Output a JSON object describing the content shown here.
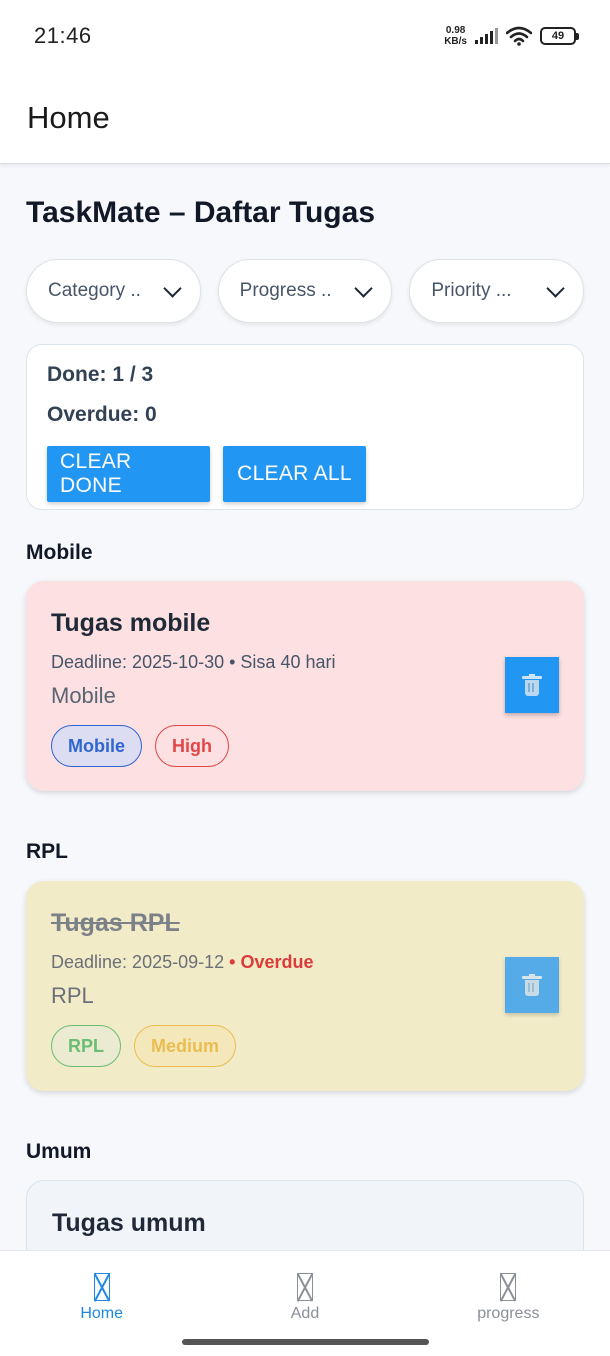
{
  "status_bar": {
    "time": "21:46",
    "net_speed_value": "0.98",
    "net_speed_unit": "KB/s",
    "battery": "49"
  },
  "app_bar": {
    "title": "Home"
  },
  "page": {
    "title": "TaskMate – Daftar Tugas"
  },
  "filters": [
    {
      "label": "Category .."
    },
    {
      "label": "Progress .."
    },
    {
      "label": "Priority ..."
    }
  ],
  "summary": {
    "done": "Done: 1 / 3",
    "overdue": "Overdue: 0",
    "clear_done_label": "CLEAR DONE",
    "clear_all_label": "CLEAR ALL"
  },
  "sections": [
    {
      "heading": "Mobile",
      "task": {
        "title": "Tugas mobile",
        "deadline": "Deadline: 2025-10-30 • Sisa 40 hari",
        "category": "Mobile",
        "chip_category": "Mobile",
        "chip_priority": "High",
        "done": false,
        "card_color": "#fde0e1"
      }
    },
    {
      "heading": "RPL",
      "task": {
        "title": "Tugas RPL",
        "deadline_prefix": "Deadline: 2025-09-12 ",
        "deadline_status": "• Overdue",
        "category": "RPL",
        "chip_category": "RPL",
        "chip_priority": "Medium",
        "done": true,
        "card_color": "#f1ebc8"
      }
    },
    {
      "heading": "Umum",
      "task": {
        "title": "Tugas umum",
        "card_color": "#f1f4f9"
      }
    }
  ],
  "bottom_nav": [
    {
      "label": "Home",
      "active": true
    },
    {
      "label": "Add",
      "active": false
    },
    {
      "label": "progress",
      "active": false
    }
  ],
  "colors": {
    "accent": "#2196f3",
    "overdue": "#dc3b3b",
    "chip_mobile_bg": "#dcdcf2",
    "chip_mobile_border": "#2f66cf",
    "chip_high_border": "#e04848",
    "chip_rpl_border": "#3fae58",
    "chip_medium_border": "#e9ae2a"
  }
}
